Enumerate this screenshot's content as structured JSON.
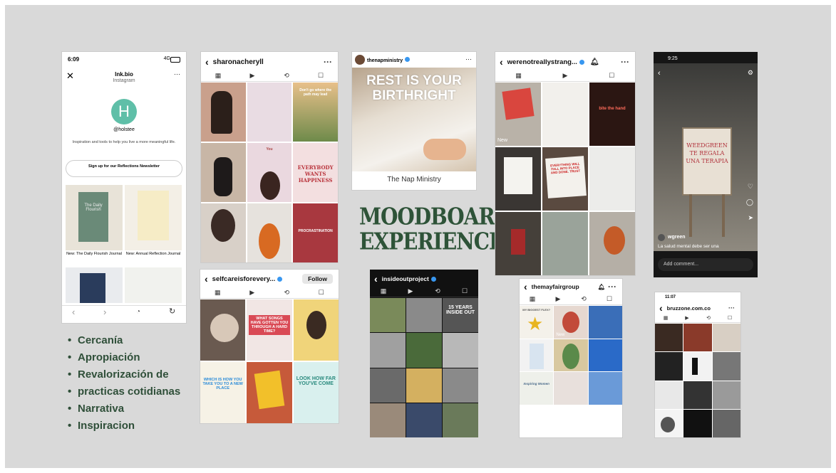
{
  "title": {
    "line1": "MOODBOARD",
    "line2": "EXPERIENCIAL"
  },
  "bullets": [
    "Cercanía",
    "Apropiación",
    "Revalorización de",
    "practicas cotidianas",
    "Narrativa",
    "Inspiracion"
  ],
  "colors": {
    "background": "#d9d9d9",
    "accent_green": "#2e5338",
    "verified_blue": "#3897f0"
  },
  "lnkbio": {
    "time": "6:09",
    "signal": "4G",
    "url": "lnk.bio",
    "source": "Instagram",
    "avatar_letter": "H",
    "handle": "@holstee",
    "description": "Inspiration and tools to help you live a more meaningful life.",
    "signup_button": "Sign up for our Reflections Newsletter",
    "book1_title": "The Daily Flourish",
    "item1": "New: The Daily Flourish Journal",
    "item2": "New: Annual Reflection Journal"
  },
  "sharon": {
    "username": "sharonacheryll",
    "tile_texts": {
      "t3": "Don't go where the path may lead",
      "t7": "You",
      "t8": "EVERYBODY WANTS HAPPINESS",
      "t12": "PROCRASTINATION"
    }
  },
  "nap": {
    "username": "thenapministry",
    "headline": "REST IS YOUR BIRTHRIGHT",
    "footer": "The Nap Ministry"
  },
  "werenot": {
    "username": "werenotreallystrang...",
    "tile_texts": {
      "new": "New",
      "t3": "bite the hand",
      "t8": "EVERYTHING WILL FALL INTO PLACE AND DONE. TRUST"
    }
  },
  "weedgreen": {
    "time": "9:25",
    "sign_line1": "WEEDGREEN",
    "sign_line2": "TE REGALA",
    "sign_line3": "UNA TERAPIA",
    "account": "wgreen",
    "caption": "La salud mental debe ser una",
    "comment_placeholder": "Add comment..."
  },
  "selfcare": {
    "username": "selfcareisforevery...",
    "follow_button": "Follow",
    "tile_texts": {
      "t2": "WHAT SONGS HAVE GOTTEN YOU THROUGH A HARD TIME?",
      "t4": "WHICH IS HOW YOU TAKE YOU TO A NEW PLACE",
      "t6": "LOOK HOW FAR YOU'VE COME"
    }
  },
  "insideout": {
    "username": "insideoutproject",
    "tile_texts": {
      "t3": "15 YEARS INSIDE OUT"
    }
  },
  "mayfair": {
    "username": "themayfairgroup",
    "tile_texts": {
      "t1": "MY BIGGEST FLEX?",
      "new": "New",
      "t10": "Inspiring Women"
    }
  },
  "bruzzone": {
    "time": "11:07",
    "username": "bruzzone.com.co"
  }
}
